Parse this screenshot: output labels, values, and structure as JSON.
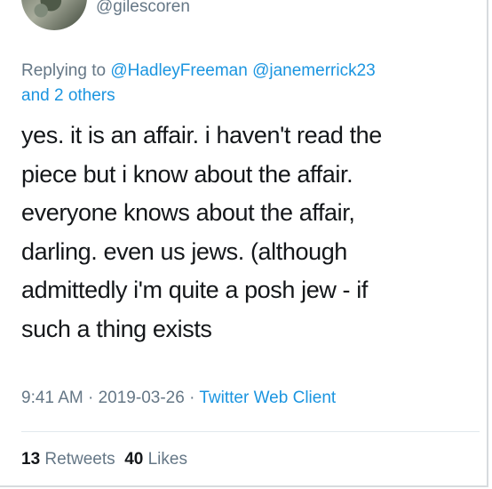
{
  "author": {
    "handle": "@gilescoren"
  },
  "reply": {
    "prefix": "Replying to",
    "mentions": [
      "@HadleyFreeman",
      "@janemerrick23"
    ],
    "others": "and 2 others"
  },
  "tweet": {
    "lines": [
      "yes. it is an affair. i haven't read the",
      "piece but i know about the affair.",
      "everyone knows about the affair,",
      "darling. even us jews. (although",
      "admittedly i'm quite a posh jew - if",
      "such a thing exists"
    ]
  },
  "meta": {
    "time": "9:41 AM",
    "date": "2019-03-26",
    "client": "Twitter Web Client",
    "separator": "·"
  },
  "stats": {
    "retweets_count": "13",
    "retweets_label": "Retweets",
    "likes_count": "40",
    "likes_label": "Likes"
  },
  "colors": {
    "link": "#1b95e0",
    "muted": "#657786",
    "text": "#14171a"
  }
}
